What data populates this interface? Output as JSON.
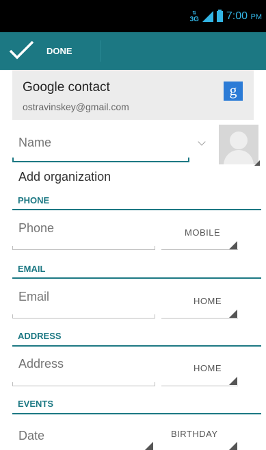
{
  "status_bar": {
    "network": "3G",
    "time": "7:00",
    "ampm": "PM"
  },
  "action_bar": {
    "done_label": "DONE"
  },
  "account": {
    "title": "Google contact",
    "email": "ostravinskey@gmail.com",
    "icon_letter": "g"
  },
  "name": {
    "placeholder": "Name"
  },
  "organization": {
    "label": "Add organization"
  },
  "phone": {
    "header": "PHONE",
    "placeholder": "Phone",
    "type": "MOBILE"
  },
  "email": {
    "header": "EMAIL",
    "placeholder": "Email",
    "type": "HOME"
  },
  "address": {
    "header": "ADDRESS",
    "placeholder": "Address",
    "type": "HOME"
  },
  "events": {
    "header": "EVENTS",
    "placeholder": "Date",
    "type": "BIRTHDAY"
  },
  "colors": {
    "accent": "#1c7883",
    "status_icon": "#33b5e5"
  }
}
